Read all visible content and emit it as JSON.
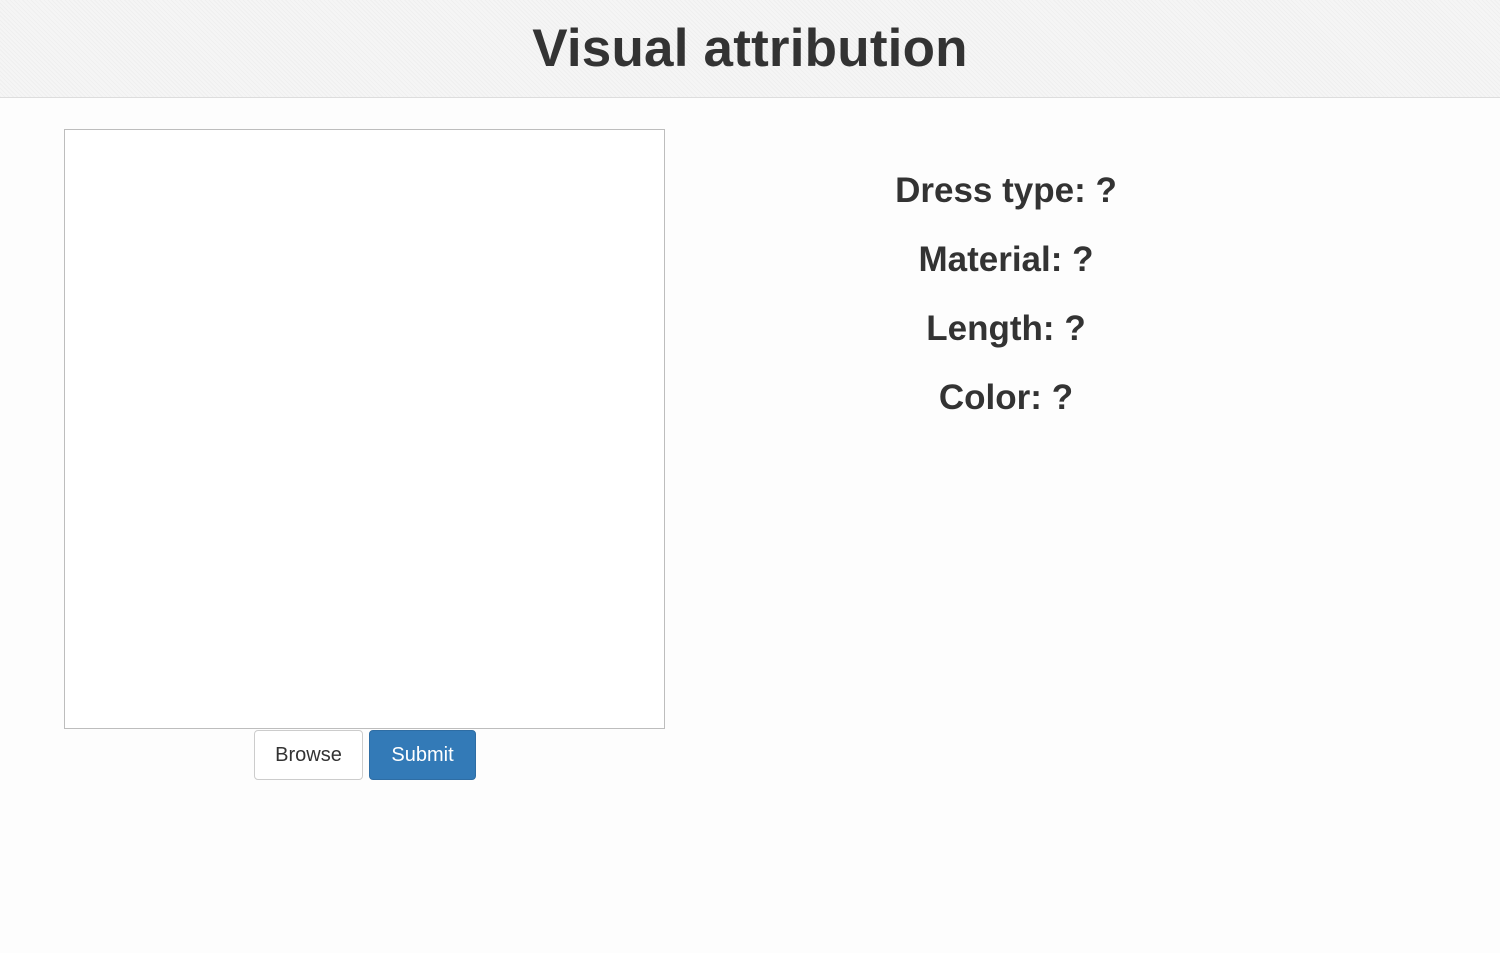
{
  "header": {
    "title": "Visual attribution"
  },
  "upload": {
    "browse_label": "Browse",
    "submit_label": "Submit"
  },
  "attributes": {
    "items": [
      {
        "label": "Dress type:",
        "value": "?"
      },
      {
        "label": "Material:",
        "value": "?"
      },
      {
        "label": "Length:",
        "value": "?"
      },
      {
        "label": "Color:",
        "value": "?"
      }
    ]
  },
  "colors": {
    "primary": "#337ab7",
    "text": "#333333",
    "header_bg": "#f5f5f5"
  }
}
